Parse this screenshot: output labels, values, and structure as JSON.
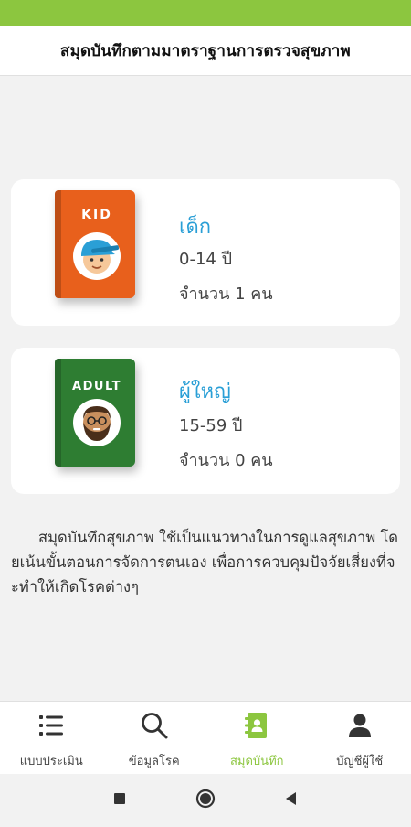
{
  "header": {
    "title": "สมุดบันทึกตามมาตราฐานการตรวจสุขภาพ"
  },
  "cards": [
    {
      "badge": "KID",
      "title": "เด็ก",
      "age": "0-14 ปี",
      "count": "จำนวน 1 คน",
      "book_color": "#e8601c"
    },
    {
      "badge": "ADULT",
      "title": "ผู้ใหญ่",
      "age": "15-59 ปี",
      "count": "จำนวน 0 คน",
      "book_color": "#2e7d32"
    }
  ],
  "description": "สมุดบันทึกสุขภาพ ใช้เป็นแนวทางในการดูแลสุขภาพ โดยเน้นขั้นตอนการจัดการตนเอง เพื่อการควบคุมปัจจัยเสี่ยงที่จะทำให้เกิดโรคต่างๆ",
  "bottom_nav": [
    {
      "label": "แบบประเมิน",
      "icon": "list-icon",
      "active": false
    },
    {
      "label": "ข้อมูลโรค",
      "icon": "search-icon",
      "active": false
    },
    {
      "label": "สมุดบันทึก",
      "icon": "address-book-icon",
      "active": true
    },
    {
      "label": "บัญชีผู้ใช้",
      "icon": "person-icon",
      "active": false
    }
  ],
  "colors": {
    "accent": "#8cc63f",
    "title_blue": "#2a9fd6"
  },
  "android_nav": [
    "recents-icon",
    "home-icon",
    "back-icon"
  ]
}
